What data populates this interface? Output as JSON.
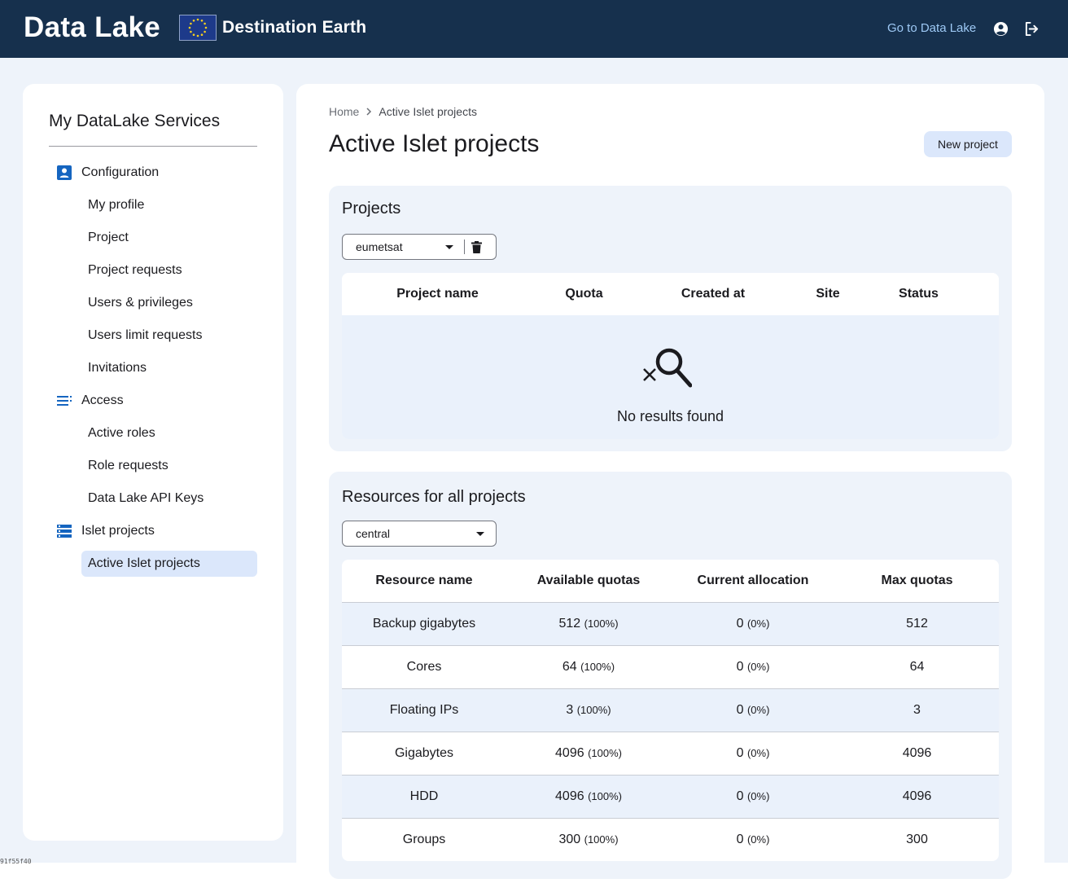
{
  "header": {
    "brand": "Data Lake",
    "logo_text": "Destination Earth",
    "go_link": "Go to Data Lake",
    "icons": [
      "account-icon",
      "logout-icon"
    ]
  },
  "sidebar": {
    "title": "My DataLake Services",
    "groups": [
      {
        "label": "Configuration",
        "icon": "account-box-icon",
        "items": [
          "My profile",
          "Project",
          "Project requests",
          "Users & privileges",
          "Users limit requests",
          "Invitations"
        ]
      },
      {
        "label": "Access",
        "icon": "list-icon",
        "items": [
          "Active roles",
          "Role requests",
          "Data Lake API Keys"
        ]
      },
      {
        "label": "Islet projects",
        "icon": "table-list-icon",
        "items": [
          "Active Islet projects"
        ]
      }
    ],
    "active_item": "Active Islet projects"
  },
  "main": {
    "breadcrumb": {
      "home": "Home",
      "current": "Active Islet projects"
    },
    "title": "Active Islet projects",
    "new_button": "New project",
    "projects": {
      "title": "Projects",
      "selected": "eumetsat",
      "columns": [
        "Project name",
        "Quota",
        "Created at",
        "Site",
        "Status"
      ],
      "empty_text": "No results found"
    },
    "resources": {
      "title": "Resources for all projects",
      "selected": "central",
      "columns": [
        "Resource name",
        "Available quotas",
        "Current allocation",
        "Max quotas"
      ],
      "rows": [
        {
          "name": "Backup gigabytes",
          "available": "512",
          "available_pct": "(100%)",
          "current": "0",
          "current_pct": "(0%)",
          "max": "512"
        },
        {
          "name": "Cores",
          "available": "64",
          "available_pct": "(100%)",
          "current": "0",
          "current_pct": "(0%)",
          "max": "64"
        },
        {
          "name": "Floating IPs",
          "available": "3",
          "available_pct": "(100%)",
          "current": "0",
          "current_pct": "(0%)",
          "max": "3"
        },
        {
          "name": "Gigabytes",
          "available": "4096",
          "available_pct": "(100%)",
          "current": "0",
          "current_pct": "(0%)",
          "max": "4096"
        },
        {
          "name": "HDD",
          "available": "4096",
          "available_pct": "(100%)",
          "current": "0",
          "current_pct": "(0%)",
          "max": "4096"
        },
        {
          "name": "Groups",
          "available": "300",
          "available_pct": "(100%)",
          "current": "0",
          "current_pct": "(0%)",
          "max": "300"
        }
      ]
    }
  },
  "footer_id": "91f55f40"
}
